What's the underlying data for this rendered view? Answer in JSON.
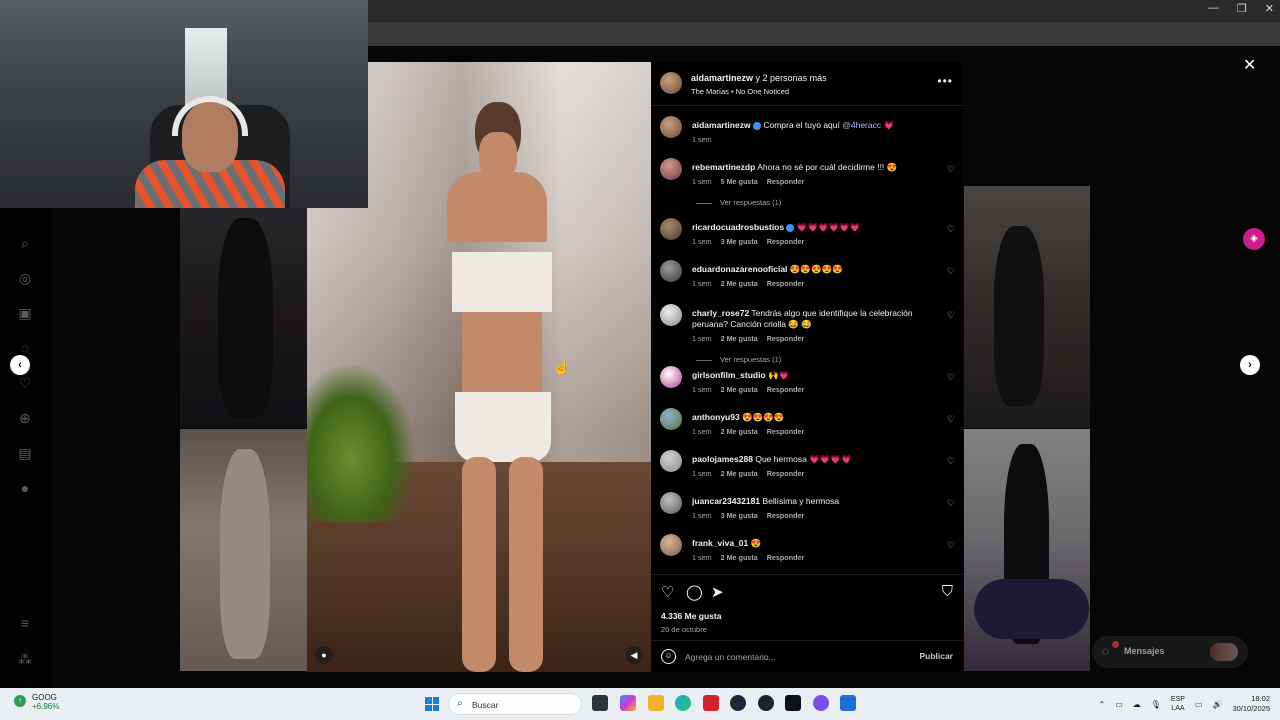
{
  "browser": {
    "title": "",
    "toolbar_icons": [
      "apps-icon",
      "star-icon",
      "extension-icon",
      "brush-icon",
      "favorites-icon",
      "profile-icon",
      "more-icon",
      "copilot-icon"
    ]
  },
  "post": {
    "author": "aidamartinezw",
    "coauthors": "y 2 personas más",
    "audio": "The Marías • No One Noticed",
    "caption_user": "aidamartinezw",
    "caption_text": "Compra el tuyo aquí",
    "caption_tag": "@4heracc",
    "caption_emoji": "💗",
    "caption_time": "1 sem",
    "likes": "4.336 Me gusta",
    "date": "20 de octubre",
    "composer_placeholder": "Agrega un comentario...",
    "publish_label": "Publicar",
    "reply_label": "Responder"
  },
  "comments": [
    {
      "user": "rebemartinezdp",
      "verified": false,
      "text": "Ahora no sé por cuál decidirme !!! 😍",
      "time": "1 sem",
      "likes": "5 Me gusta",
      "replies": "Ver respuestas (1)"
    },
    {
      "user": "ricardocuadrosbustios",
      "verified": true,
      "text": "💗💗💗💗💗💗",
      "time": "1 sem",
      "likes": "3 Me gusta",
      "replies": ""
    },
    {
      "user": "eduardonazarenooficial",
      "verified": false,
      "text": "😍😍😍😍😍",
      "time": "1 sem",
      "likes": "2 Me gusta",
      "replies": ""
    },
    {
      "user": "charly_rose72",
      "verified": false,
      "text": "Tendrás algo que identifique la celebración peruana? Canción criolla 😂 😂",
      "time": "1 sem",
      "likes": "2 Me gusta",
      "replies": "Ver respuestas (1)"
    },
    {
      "user": "girlsonfilm_studio",
      "verified": false,
      "text": "🙌💗",
      "time": "1 sem",
      "likes": "2 Me gusta",
      "replies": ""
    },
    {
      "user": "anthonyu93",
      "verified": false,
      "text": "😍😍😍😍",
      "time": "1 sem",
      "likes": "2 Me gusta",
      "replies": ""
    },
    {
      "user": "paolojames288",
      "verified": false,
      "text": "Que hermosa 💗💗💗💗",
      "time": "1 sem",
      "likes": "2 Me gusta",
      "replies": ""
    },
    {
      "user": "juancar23432181",
      "verified": false,
      "text": "Bellísima y hermosa",
      "time": "1 sem",
      "likes": "3 Me gusta",
      "replies": ""
    },
    {
      "user": "frank_viva_01",
      "verified": false,
      "text": "😍",
      "time": "1 sem",
      "likes": "2 Me gusta",
      "replies": ""
    }
  ],
  "messages": {
    "label": "Mensajes"
  },
  "taskbar": {
    "stock_ticker": "GOOG",
    "stock_change": "+6.96%",
    "search_label": "Buscar",
    "lang_top": "ESP",
    "lang_bottom": "LAA",
    "time": "18:02",
    "date": "30/10/2025"
  },
  "colors": {
    "accent_pink": "#ff3d7a",
    "verified_blue": "#3897f0",
    "panel_bg": "#000000"
  }
}
